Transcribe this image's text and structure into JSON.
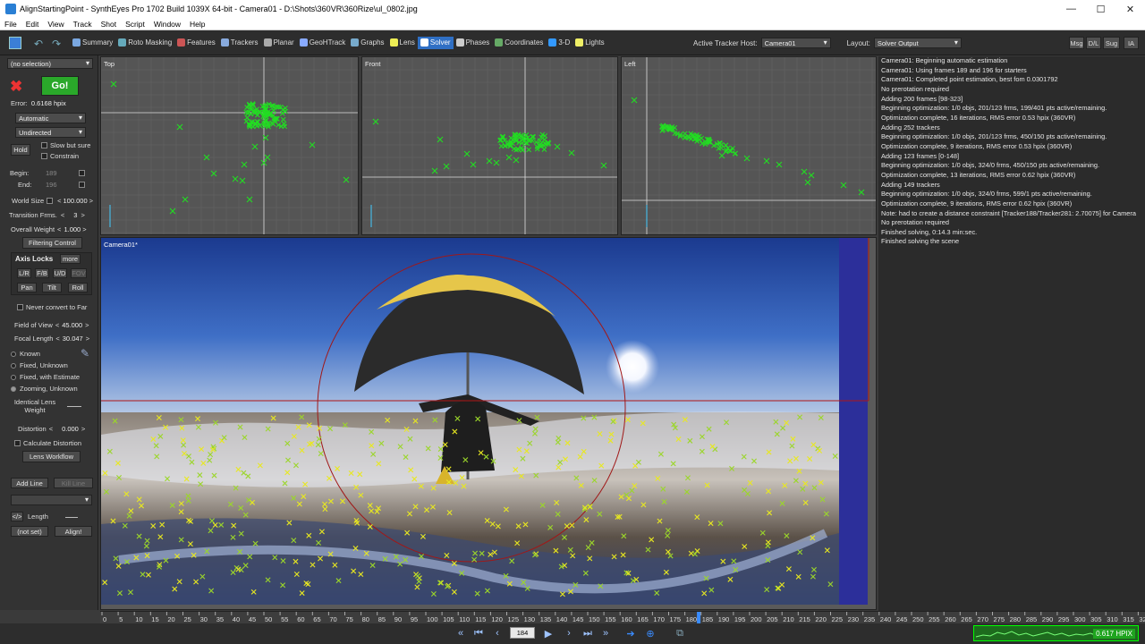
{
  "window": {
    "title": "AlignStartingPoint - SynthEyes Pro 1702 Build 1039X 64-bit - Camera01 - D:\\Shots\\360VR\\360Rize\\ul_0802.jpg",
    "minimize": "—",
    "maximize": "☐",
    "close": "✕"
  },
  "menu": [
    "File",
    "Edit",
    "View",
    "Track",
    "Shot",
    "Script",
    "Window",
    "Help"
  ],
  "toolbar": {
    "rooms": [
      {
        "label": "Summary",
        "icon": "summary-icon",
        "active": false
      },
      {
        "label": "Roto Masking",
        "icon": "roto-icon",
        "active": false
      },
      {
        "label": "Features",
        "icon": "features-icon",
        "active": false
      },
      {
        "label": "Trackers",
        "icon": "trackers-icon",
        "active": false
      },
      {
        "label": "Planar",
        "icon": "planar-icon",
        "active": false
      },
      {
        "label": "GeoHTrack",
        "icon": "geoh-icon",
        "active": false
      },
      {
        "label": "Graphs",
        "icon": "graphs-icon",
        "active": false
      },
      {
        "label": "Lens",
        "icon": "lens-icon",
        "active": false
      },
      {
        "label": "Solver",
        "icon": "solver-icon",
        "active": true
      },
      {
        "label": "Phases",
        "icon": "phases-icon",
        "active": false
      },
      {
        "label": "Coordinates",
        "icon": "coordinates-icon",
        "active": false
      },
      {
        "label": "3-D",
        "icon": "3d-icon",
        "active": false
      },
      {
        "label": "Lights",
        "icon": "lights-icon",
        "active": false
      }
    ],
    "active_tracker_host_label": "Active Tracker Host:",
    "active_tracker_host_value": "Camera01",
    "layout_label": "Layout:",
    "layout_value": "Solver Output",
    "msg": "Msg",
    "dl": "D/L",
    "sug": "Sug",
    "ia": "IA"
  },
  "sidebar": {
    "selection": "(no selection)",
    "go": "Go!",
    "error_label": "Error:",
    "error_value": "0.6168 hpix",
    "mode": "Automatic",
    "direction": "Undirected",
    "hold": "Hold",
    "slow_but_sure": "Slow but sure",
    "constrain": "Constrain",
    "begin_label": "Begin:",
    "begin_value": "189",
    "end_label": "End:",
    "end_value": "196",
    "world_size_label": "World Size",
    "world_size_value": "100.000",
    "transition_label": "Transition Frms.",
    "transition_value": "3",
    "overall_weight_label": "Overall Weight",
    "overall_weight_value": "1.000",
    "filtering_control": "Filtering Control",
    "axis_locks": "Axis Locks",
    "more": "more",
    "lr": "L/R",
    "fb": "F/B",
    "ud": "U/D",
    "fov": "FOV",
    "pan": "Pan",
    "tilt": "Tilt",
    "roll": "Roll",
    "never_convert": "Never convert to Far",
    "fov_label": "Field of View",
    "fov_value": "45.000",
    "focal_label": "Focal Length",
    "focal_value": "30.047",
    "known": "Known",
    "fixed_unknown": "Fixed, Unknown",
    "fixed_estimate": "Fixed, with Estimate",
    "zooming_unknown": "Zooming, Unknown",
    "identical_lens_weight": "Identical Lens Weight",
    "distortion_label": "Distortion",
    "distortion_value": "0.000",
    "calculate_distortion": "Calculate Distortion",
    "lens_workflow": "Lens Workflow",
    "add_line": "Add Line",
    "kill_line": "Kill Line",
    "length": "Length",
    "not_set": "(not set)",
    "align": "Align!"
  },
  "viewports": {
    "top": "Top",
    "front": "Front",
    "left": "Left",
    "camera": "Camera01*"
  },
  "log": [
    "Camera01: Beginning automatic estimation",
    "Camera01: Using frames 189 and 196 for starters",
    "Camera01: Completed point estimation, best fom 0.0301792",
    "No prerotation required",
    "Adding 200 frames [98-323]",
    "Beginning optimization: 1/0 objs, 201/123 frms, 199/401 pts active/remaining.",
    "Optimization complete, 16 iterations, RMS error 0.53 hpix (360VR)",
    "Adding 252 trackers",
    "Beginning optimization: 1/0 objs, 201/123 frms, 450/150 pts active/remaining.",
    "Optimization complete, 9 iterations, RMS error 0.53 hpix (360VR)",
    "Adding 123 frames [0-148]",
    "Beginning optimization: 1/0 objs, 324/0 frms, 450/150 pts active/remaining.",
    "Optimization complete, 13 iterations, RMS error 0.62 hpix (360VR)",
    "Adding 149 trackers",
    "Beginning optimization: 1/0 objs, 324/0 frms, 599/1 pts active/remaining.",
    "Optimization complete, 9 iterations, RMS error 0.62 hpix (360VR)",
    "Note: had to create a distance constraint [Tracker188/Tracker281: 2.70075] for Camera",
    "No prerotation required",
    "Finished solving, 0:14.3 min:sec.",
    "Finished solving the scene"
  ],
  "timeline": {
    "ticks": [
      "0",
      "5",
      "10",
      "15",
      "20",
      "25",
      "30",
      "35",
      "40",
      "45",
      "50",
      "55",
      "60",
      "65",
      "70",
      "75",
      "80",
      "85",
      "90",
      "95",
      "100",
      "105",
      "110",
      "115",
      "120",
      "125",
      "130",
      "135",
      "140",
      "145",
      "150",
      "155",
      "160",
      "165",
      "170",
      "175",
      "180",
      "185",
      "190",
      "195",
      "200",
      "205",
      "210",
      "215",
      "220",
      "225",
      "230",
      "235",
      "240",
      "245",
      "250",
      "255",
      "260",
      "265",
      "270",
      "275",
      "280",
      "285",
      "290",
      "295",
      "300",
      "305",
      "310",
      "315",
      "320"
    ],
    "current_frame": "184"
  },
  "status": {
    "hpix": "0.617 HPIX"
  },
  "colors": {
    "tracker_green": "#22dd22",
    "tracker_yellow": "#e8e820",
    "solver_active": "#2f6fc4",
    "go_button": "#2aa82a"
  }
}
